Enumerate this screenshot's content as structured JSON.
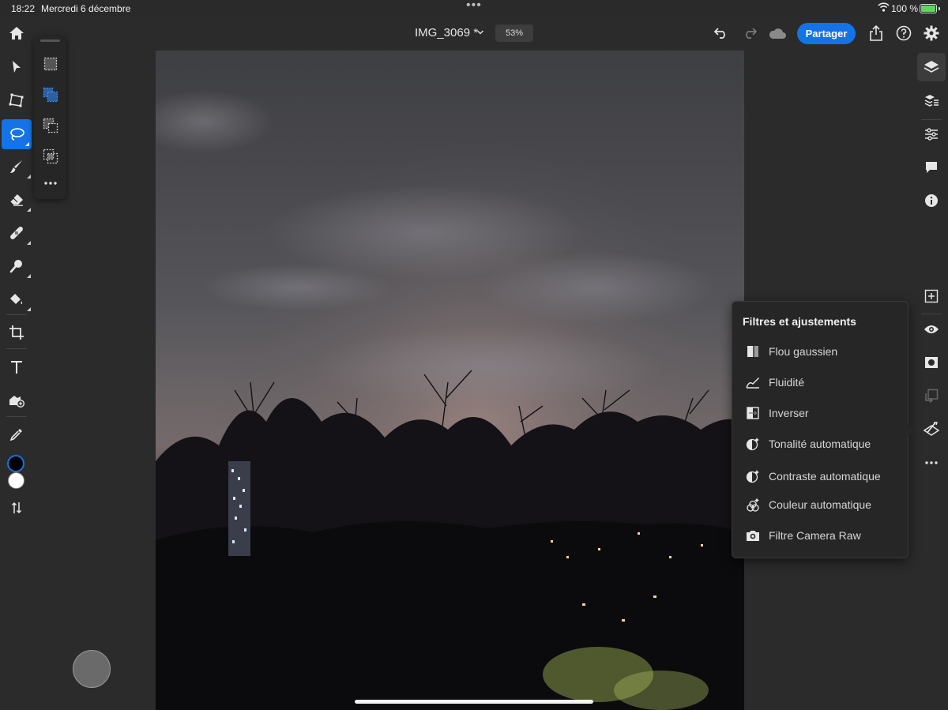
{
  "status_bar": {
    "time": "18:22",
    "date": "Mercredi 6 décembre",
    "battery": "100 %"
  },
  "header": {
    "document_title": "IMG_3069 *",
    "zoom": "53%",
    "share_label": "Partager"
  },
  "left_tools": [
    {
      "name": "select",
      "icon": "arrow-pointer-icon"
    },
    {
      "name": "transform",
      "icon": "transform-icon"
    },
    {
      "name": "lasso",
      "icon": "lasso-icon",
      "active": true
    },
    {
      "name": "brush",
      "icon": "brush-icon"
    },
    {
      "name": "eraser",
      "icon": "eraser-icon"
    },
    {
      "name": "healing",
      "icon": "bandage-icon"
    },
    {
      "name": "clone",
      "icon": "clone-stamp-icon"
    },
    {
      "name": "fill",
      "icon": "paint-bucket-icon"
    },
    {
      "name": "crop",
      "icon": "crop-icon"
    },
    {
      "name": "type",
      "icon": "text-icon"
    },
    {
      "name": "place-image",
      "icon": "image-icon"
    },
    {
      "name": "eyedropper",
      "icon": "eyedropper-icon"
    }
  ],
  "colors": {
    "accent": "#1473e6",
    "foreground_swatch": "#000000",
    "background_swatch": "#ffffff"
  },
  "selection_flyout": [
    "new-selection-icon",
    "add-selection-icon",
    "subtract-selection-icon",
    "intersect-selection-icon",
    "more-icon"
  ],
  "filters_panel": {
    "title": "Filtres et ajustements",
    "items": [
      {
        "label": "Flou gaussien",
        "icon": "gaussian-blur-icon"
      },
      {
        "label": "Fluidité",
        "icon": "liquify-icon"
      },
      {
        "label": "Inverser",
        "icon": "invert-icon"
      },
      {
        "label": "Tonalité automatique",
        "icon": "auto-tone-icon"
      },
      {
        "label": "Contraste automatique",
        "icon": "auto-contrast-icon"
      },
      {
        "label": "Couleur automatique",
        "icon": "auto-color-icon"
      },
      {
        "label": "Filtre Camera Raw",
        "icon": "camera-raw-icon"
      }
    ]
  },
  "right_tools": [
    "layers-icon",
    "layer-properties-icon",
    "adjustments-icon",
    "comments-icon",
    "info-icon",
    "add-layer-icon",
    "visibility-icon",
    "mask-icon",
    "clip-icon",
    "filters-icon",
    "more-icon"
  ]
}
